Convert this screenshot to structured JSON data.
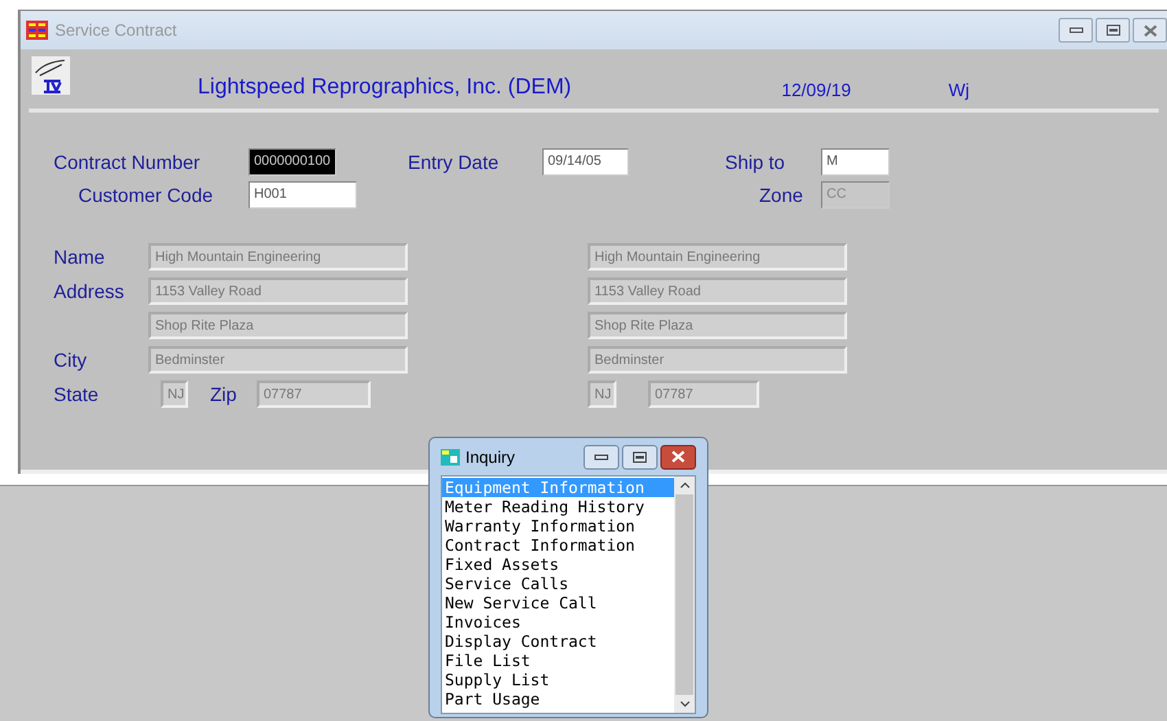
{
  "window": {
    "title": "Service Contract"
  },
  "header": {
    "company": "Lightspeed Reprographics, Inc. (DEM)",
    "date": "12/09/19",
    "user": "Wj"
  },
  "contract_number": {
    "label": "Contract Number",
    "value": "0000000100",
    "focused": true,
    "disabled": false
  },
  "entry_date": {
    "label": "Entry Date",
    "value": "09/14/05",
    "focused": false,
    "disabled": false
  },
  "ship_to": {
    "label": "Ship to",
    "value": "M",
    "focused": false,
    "disabled": false
  },
  "customer_code": {
    "label": "Customer Code",
    "value": "H001",
    "focused": false,
    "disabled": false
  },
  "zone": {
    "label": "Zone",
    "value": "CC",
    "focused": false,
    "disabled": true
  },
  "address_labels": {
    "name": "Name",
    "address": "Address",
    "city": "City",
    "state": "State",
    "zip": "Zip"
  },
  "bill_to_address": {
    "name": "High Mountain Engineering",
    "address_1": "1153 Valley Road",
    "address_2": "Shop Rite Plaza",
    "city": "Bedminster",
    "state": "NJ",
    "zip": "07787"
  },
  "ship_to_address": {
    "name": "High Mountain Engineering",
    "address_1": "1153 Valley Road",
    "address_2": "Shop Rite Plaza",
    "city": "Bedminster",
    "state": "NJ",
    "zip": "07787"
  },
  "inquiry": {
    "title": "Inquiry",
    "items": [
      {
        "label": "Equipment Information",
        "selected": true
      },
      {
        "label": "Meter Reading History",
        "selected": false
      },
      {
        "label": "Warranty Information",
        "selected": false
      },
      {
        "label": "Contract Information",
        "selected": false
      },
      {
        "label": "Fixed Assets",
        "selected": false
      },
      {
        "label": "Service Calls",
        "selected": false
      },
      {
        "label": "New Service Call",
        "selected": false
      },
      {
        "label": "Invoices",
        "selected": false
      },
      {
        "label": "Display Contract",
        "selected": false
      },
      {
        "label": "File List",
        "selected": false
      },
      {
        "label": "Supply List",
        "selected": false
      },
      {
        "label": "Part Usage",
        "selected": false
      }
    ]
  }
}
